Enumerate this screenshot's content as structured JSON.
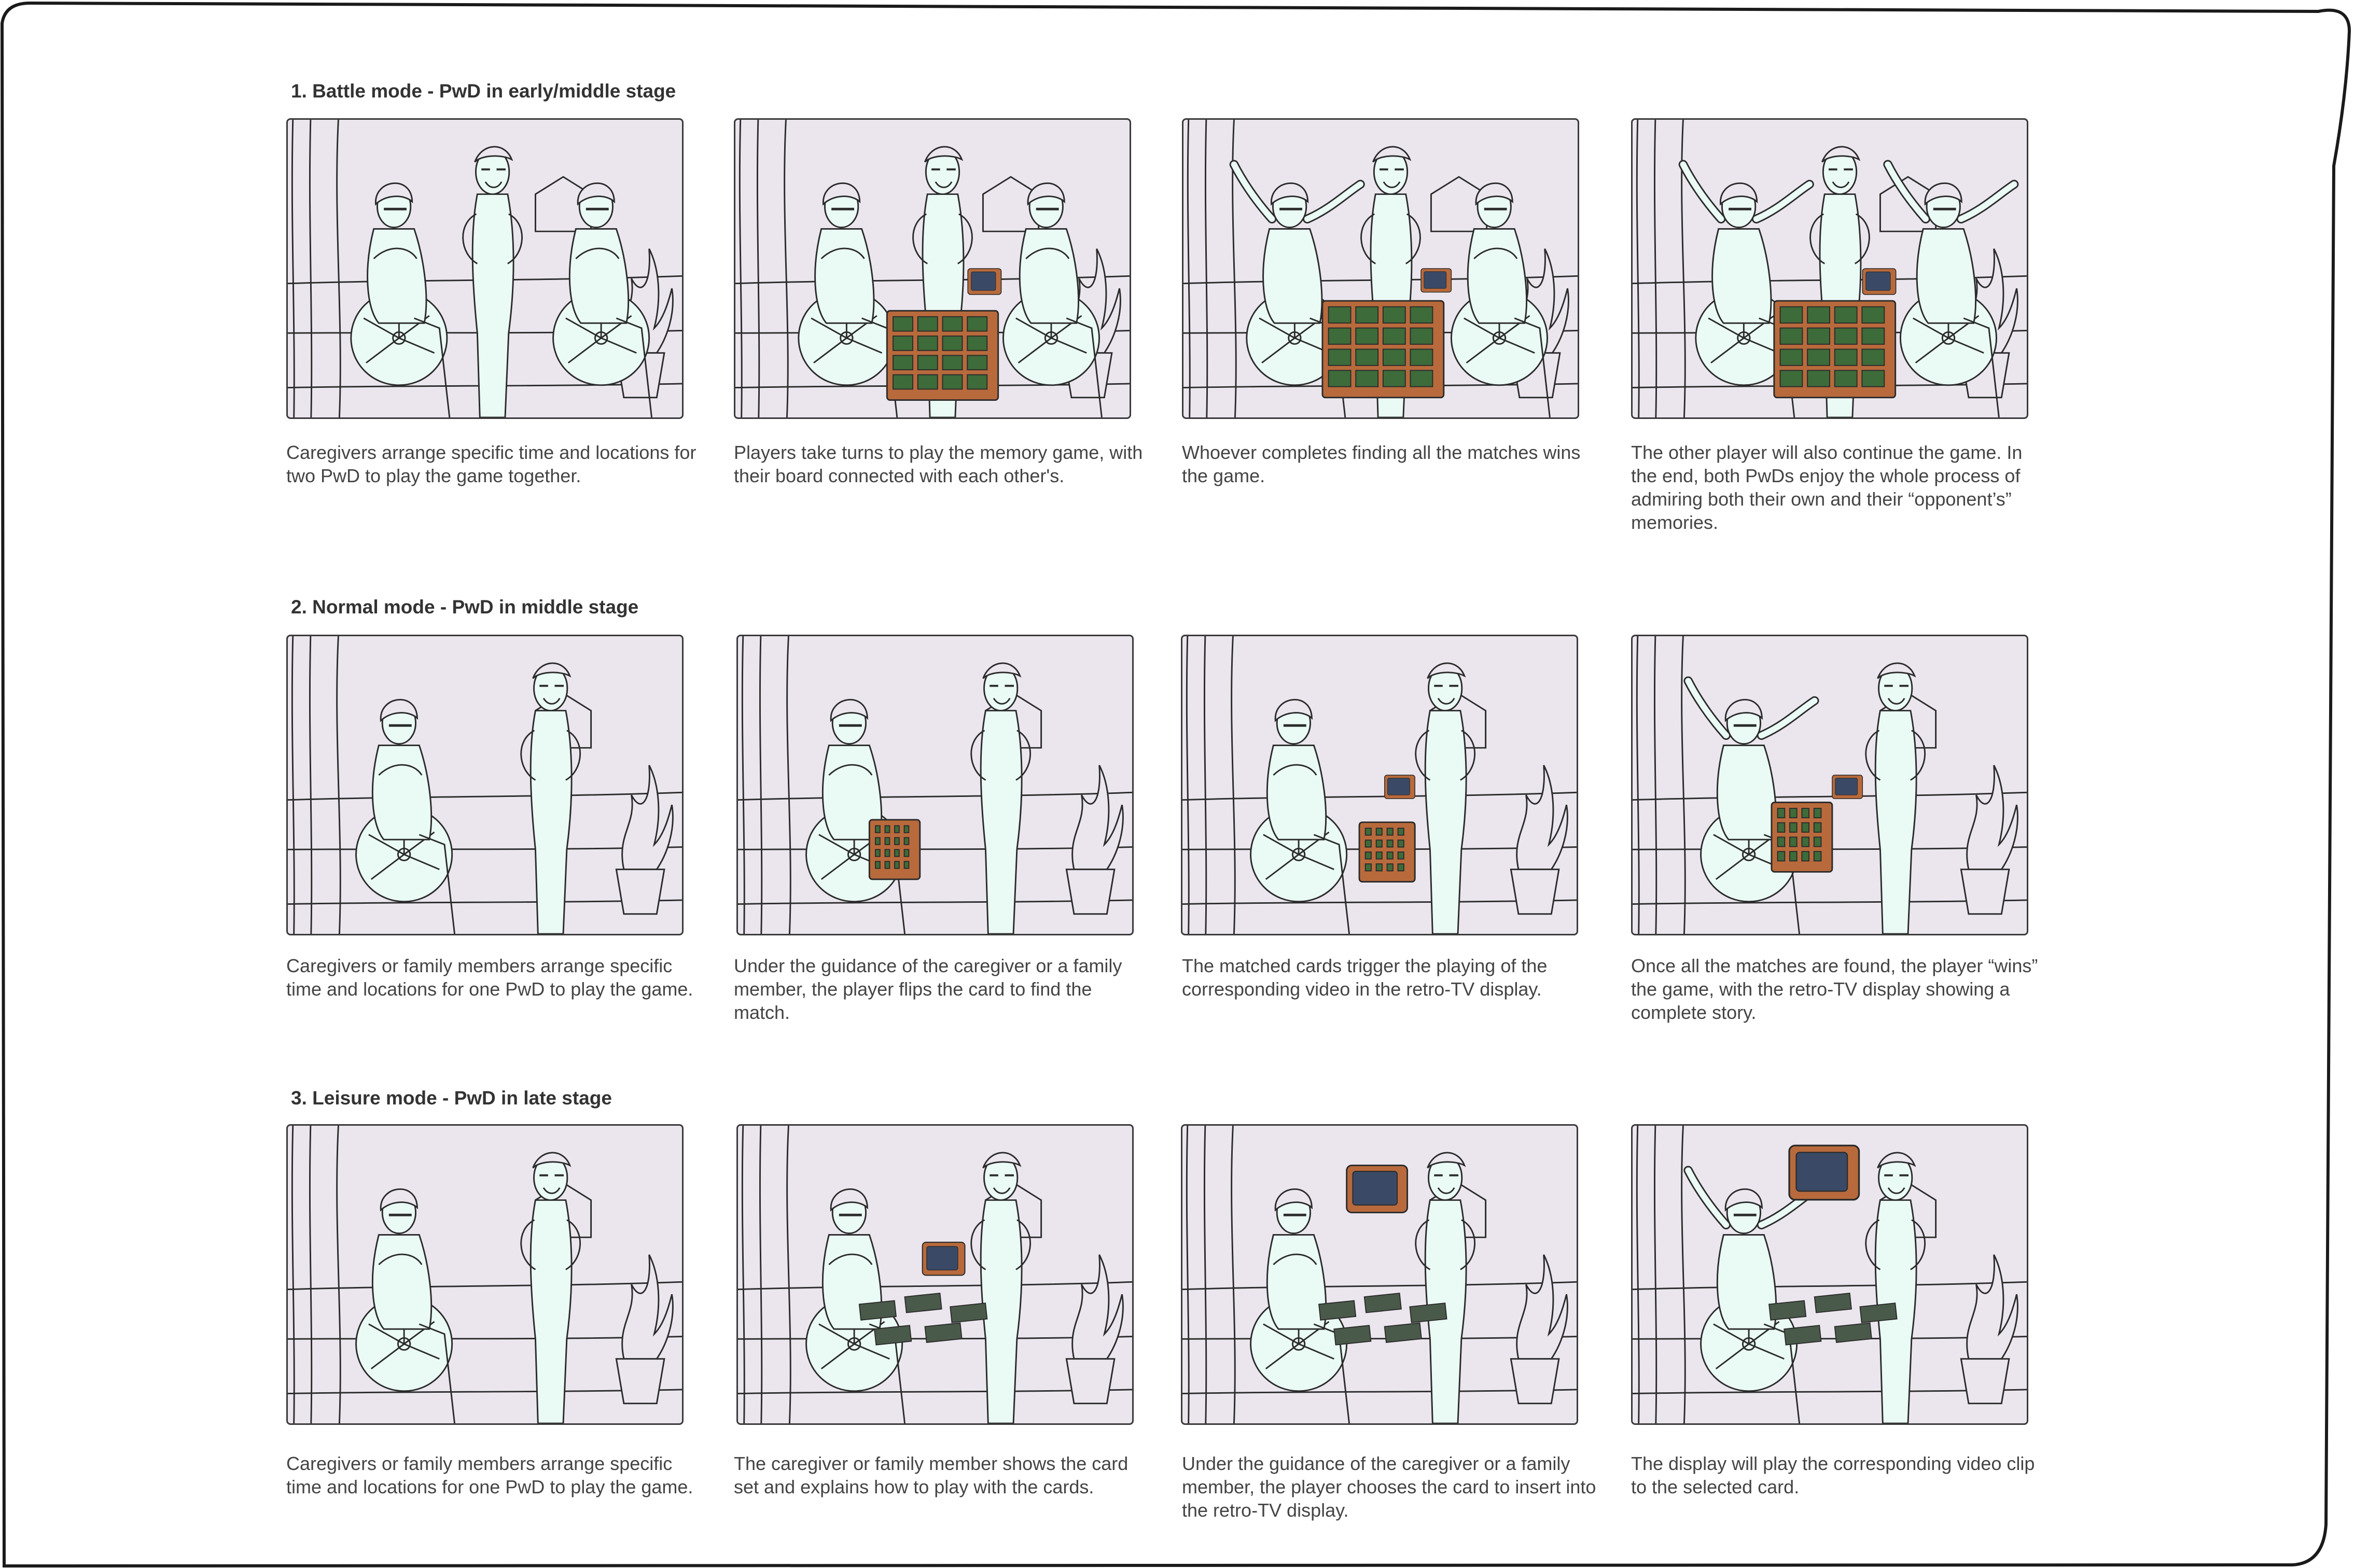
{
  "rows": [
    {
      "title": "1. Battle mode - PwD in early/middle stage",
      "panels": [
        {
          "caption": "Caregivers arrange specific time and locations for two PwD to play the game together."
        },
        {
          "caption": "Players take turns to play the memory game, with their board connected with each other's."
        },
        {
          "caption": "Whoever completes finding all the matches wins the game."
        },
        {
          "caption": "The other player will also continue the game. In the end, both PwDs enjoy the whole process of admiring both their own and their “opponent’s” memories."
        }
      ]
    },
    {
      "title": "2. Normal mode - PwD in middle stage",
      "panels": [
        {
          "caption": "Caregivers or family members arrange specific time and locations for one PwD to play the game."
        },
        {
          "caption": "Under the guidance of the caregiver or a family member, the player flips the card to find the match."
        },
        {
          "caption": "The matched cards trigger the playing of the corresponding video in the retro-TV display."
        },
        {
          "caption": "Once all the matches are found, the player “wins” the game, with the retro-TV display showing a complete story."
        }
      ]
    },
    {
      "title": "3. Leisure mode - PwD in late stage",
      "panels": [
        {
          "caption": "Caregivers or family members arrange specific time and locations for one PwD to play the game."
        },
        {
          "caption": "The caregiver or family member shows the card set and explains how to play with the cards."
        },
        {
          "caption": "Under the guidance of the caregiver or a family member, the player chooses the card to insert into the retro-TV display."
        },
        {
          "caption": "The display will play the corresponding video clip to the selected card."
        }
      ]
    }
  ],
  "colors": {
    "panel_bg": "#ebe6ee",
    "figure_fill": "#eafaf5",
    "line": "#2b2b2b",
    "board": "#b86a3c",
    "card": "#3d6b3a",
    "text": "#444444",
    "title": "#333333"
  }
}
